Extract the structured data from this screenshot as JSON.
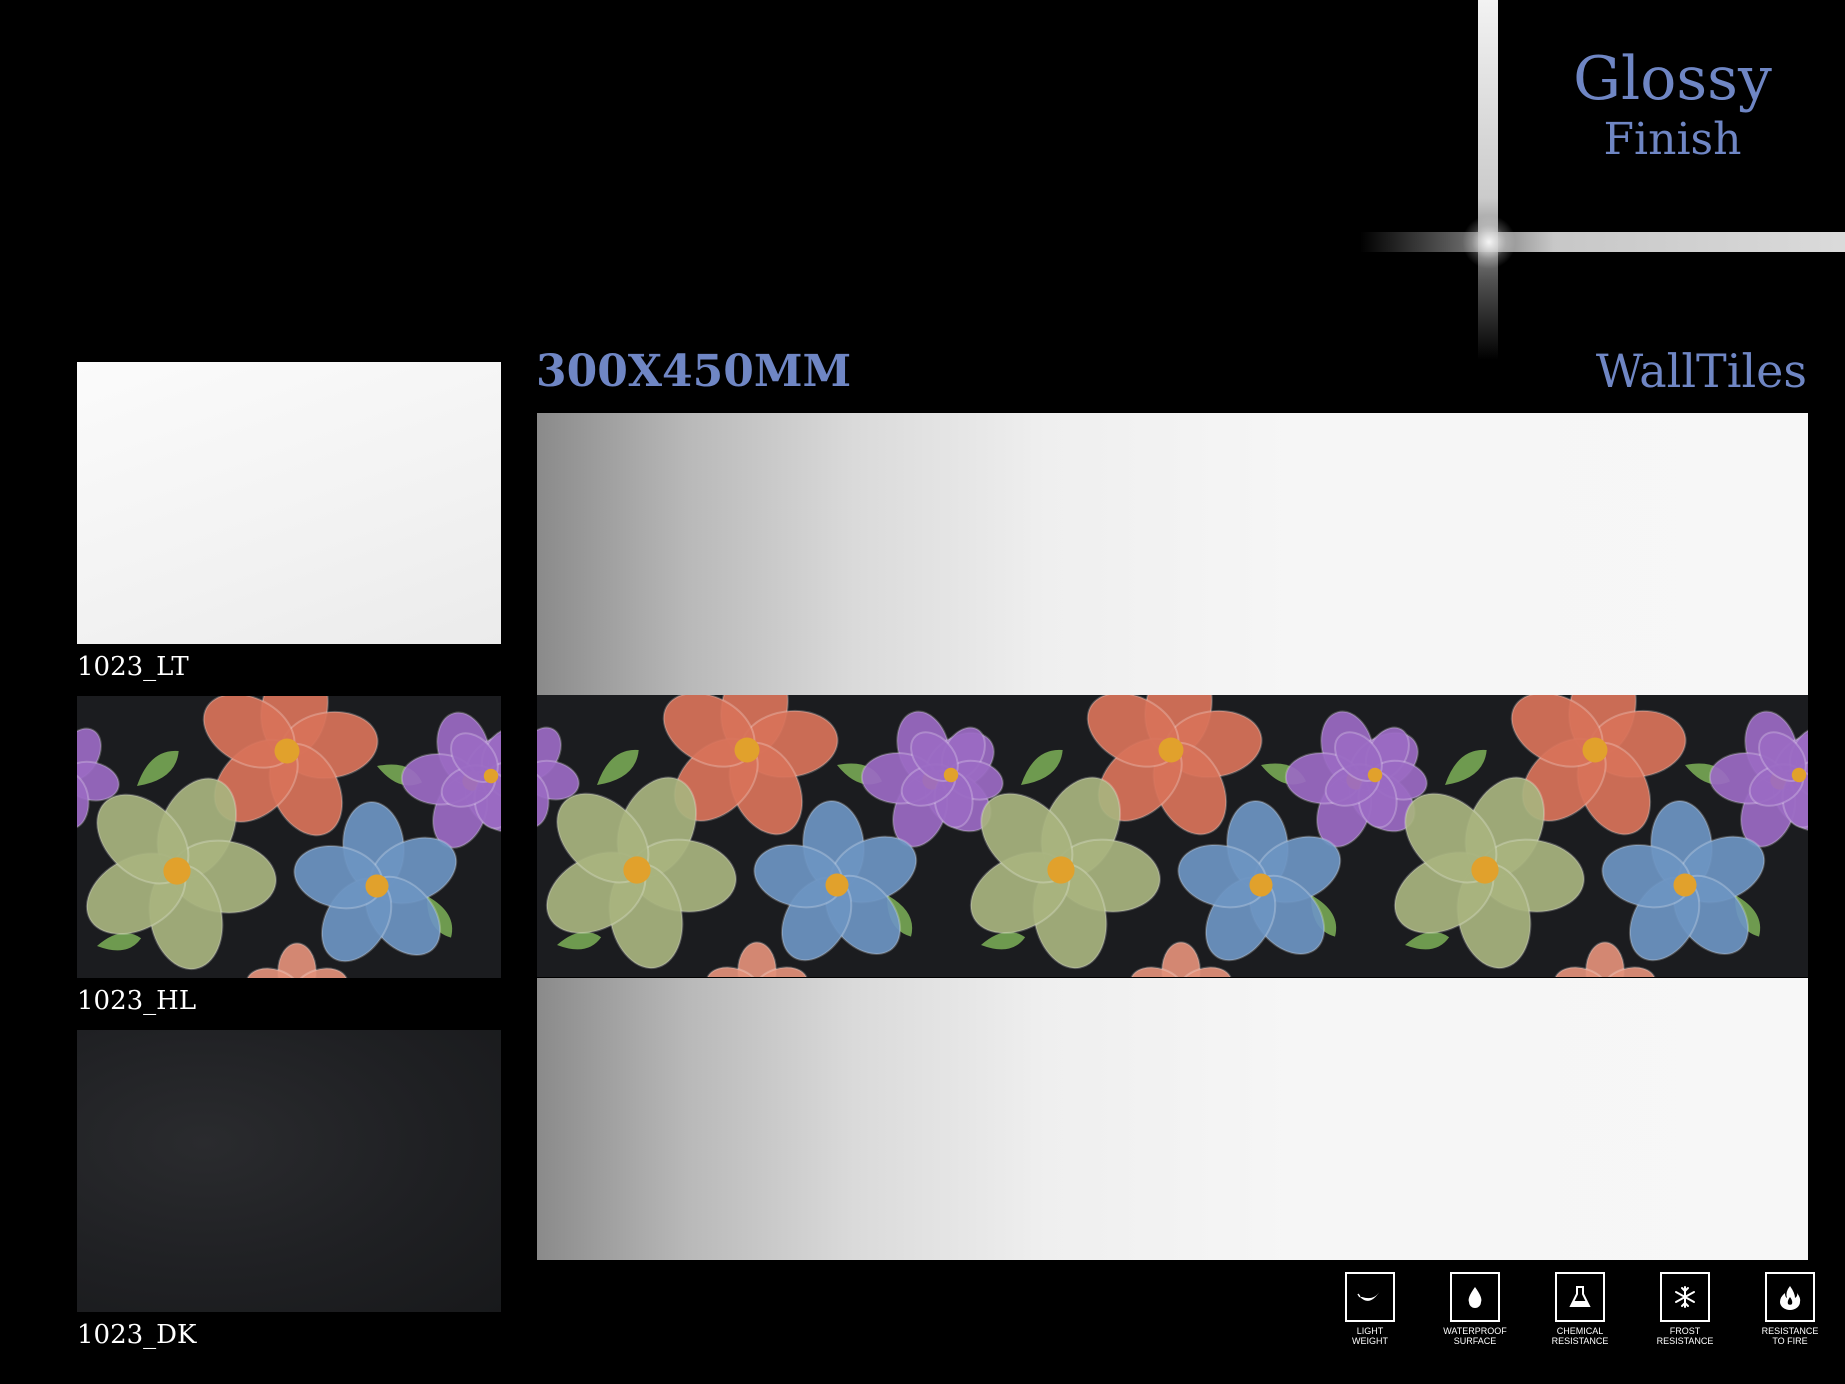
{
  "colors": {
    "accent": "#6f86c4",
    "background": "#000000"
  },
  "header": {
    "finish_title": "Glossy",
    "finish_subtitle": "Finish",
    "size": "300X450MM",
    "category": "WallTiles"
  },
  "thumbnails": [
    {
      "code": "1023_LT",
      "tone": "light"
    },
    {
      "code": "1023_HL",
      "tone": "highlighter"
    },
    {
      "code": "1023_DK",
      "tone": "dark"
    }
  ],
  "features": [
    {
      "icon": "feather-icon",
      "label": "LIGHT\nWEIGHT"
    },
    {
      "icon": "water-drop-icon",
      "label": "WATERPROOF\nSURFACE"
    },
    {
      "icon": "flask-icon",
      "label": "CHEMICAL\nRESISTANCE"
    },
    {
      "icon": "snowflake-icon",
      "label": "FROST\nRESISTANCE"
    },
    {
      "icon": "flame-icon",
      "label": "RESISTANCE\nTO FIRE"
    }
  ]
}
